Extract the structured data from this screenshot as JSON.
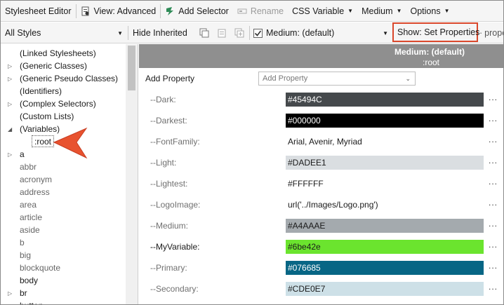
{
  "toolbar": {
    "title": "Stylesheet Editor",
    "view": "View: Advanced",
    "add_selector": "Add Selector",
    "rename": "Rename",
    "css_variable": "CSS Variable",
    "medium": "Medium",
    "options": "Options"
  },
  "filterbar": {
    "styles_select": "All Styles",
    "hide_inherited": "Hide Inherited",
    "medium_select": "Medium: (default)",
    "show_set": "Show: Set Properties",
    "overflow": "prope"
  },
  "tree": {
    "items": [
      {
        "label": "(Linked Stylesheets)",
        "expand": false
      },
      {
        "label": "(Generic Classes)",
        "expand": "right"
      },
      {
        "label": "(Generic Pseudo Classes)",
        "expand": "right"
      },
      {
        "label": "(Identifiers)",
        "expand": false
      },
      {
        "label": "(Complex Selectors)",
        "expand": "right"
      },
      {
        "label": "(Custom Lists)",
        "expand": false
      },
      {
        "label": "(Variables)",
        "expand": "down"
      },
      {
        "label": ":root",
        "expand": false
      },
      {
        "label": "a",
        "expand": "right"
      },
      {
        "label": "abbr",
        "expand": false
      },
      {
        "label": "acronym",
        "expand": false
      },
      {
        "label": "address",
        "expand": false
      },
      {
        "label": "area",
        "expand": false
      },
      {
        "label": "article",
        "expand": false
      },
      {
        "label": "aside",
        "expand": false
      },
      {
        "label": "b",
        "expand": false
      },
      {
        "label": "big",
        "expand": false
      },
      {
        "label": "blockquote",
        "expand": false
      },
      {
        "label": "body",
        "expand": false
      },
      {
        "label": "br",
        "expand": "right"
      },
      {
        "label": "button",
        "expand": false
      }
    ]
  },
  "panel": {
    "header_medium": "Medium: (default)",
    "header_selector": ":root",
    "add_property_label": "Add Property",
    "add_property_placeholder": "Add Property",
    "properties": [
      {
        "name": "--Dark:",
        "value": "#45494C",
        "bg": "#45494C",
        "fg": "#ffffff"
      },
      {
        "name": "--Darkest:",
        "value": "#000000",
        "bg": "#000000",
        "fg": "#ffffff"
      },
      {
        "name": "--FontFamily:",
        "value": "Arial, Avenir, Myriad",
        "bg": "#ffffff",
        "fg": "#1a1a1a"
      },
      {
        "name": "--Light:",
        "value": "#DADEE1",
        "bg": "#DADEE1",
        "fg": "#1a1a1a"
      },
      {
        "name": "--Lightest:",
        "value": "#FFFFFF",
        "bg": "#ffffff",
        "fg": "#1a1a1a"
      },
      {
        "name": "--LogoImage:",
        "value": "url('../Images/Logo.png')",
        "bg": "#ffffff",
        "fg": "#1a1a1a"
      },
      {
        "name": "--Medium:",
        "value": "#A4AAAE",
        "bg": "#A4AAAE",
        "fg": "#1a1a1a"
      },
      {
        "name": "--MyVariable:",
        "value": "#6be42e",
        "bg": "#6be42e",
        "fg": "#1a1a1a"
      },
      {
        "name": "--Primary:",
        "value": "#076685",
        "bg": "#076685",
        "fg": "#ffffff"
      },
      {
        "name": "--Secondary:",
        "value": "#CDE0E7",
        "bg": "#CDE0E7",
        "fg": "#1a1a1a"
      }
    ],
    "more": "..."
  },
  "colors": {
    "highlight_box": "#d9472b",
    "callout_arrow": "#e8522f"
  }
}
